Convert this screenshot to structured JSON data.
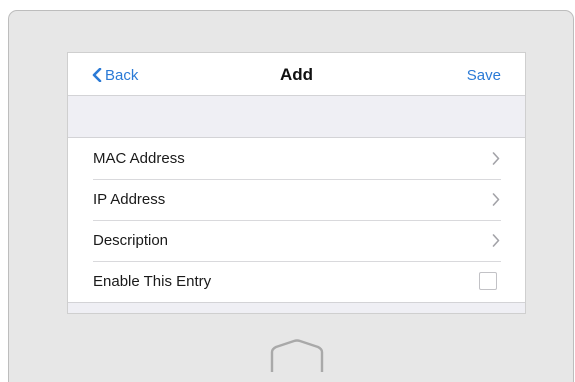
{
  "navbar": {
    "back_label": "Back",
    "title": "Add",
    "save_label": "Save"
  },
  "list": {
    "items": [
      {
        "label": "MAC Address",
        "accessory": "chevron-right-icon"
      },
      {
        "label": "IP Address",
        "accessory": "chevron-right-icon"
      },
      {
        "label": "Description",
        "accessory": "chevron-right-icon"
      },
      {
        "label": "Enable This Entry",
        "accessory": "checkbox",
        "checked": false
      }
    ]
  },
  "device": {
    "home_button_icon": "home-icon"
  },
  "colors": {
    "accent": "#2a7ad6",
    "frame": "#e7e7e7",
    "group_background": "#efeff4"
  }
}
